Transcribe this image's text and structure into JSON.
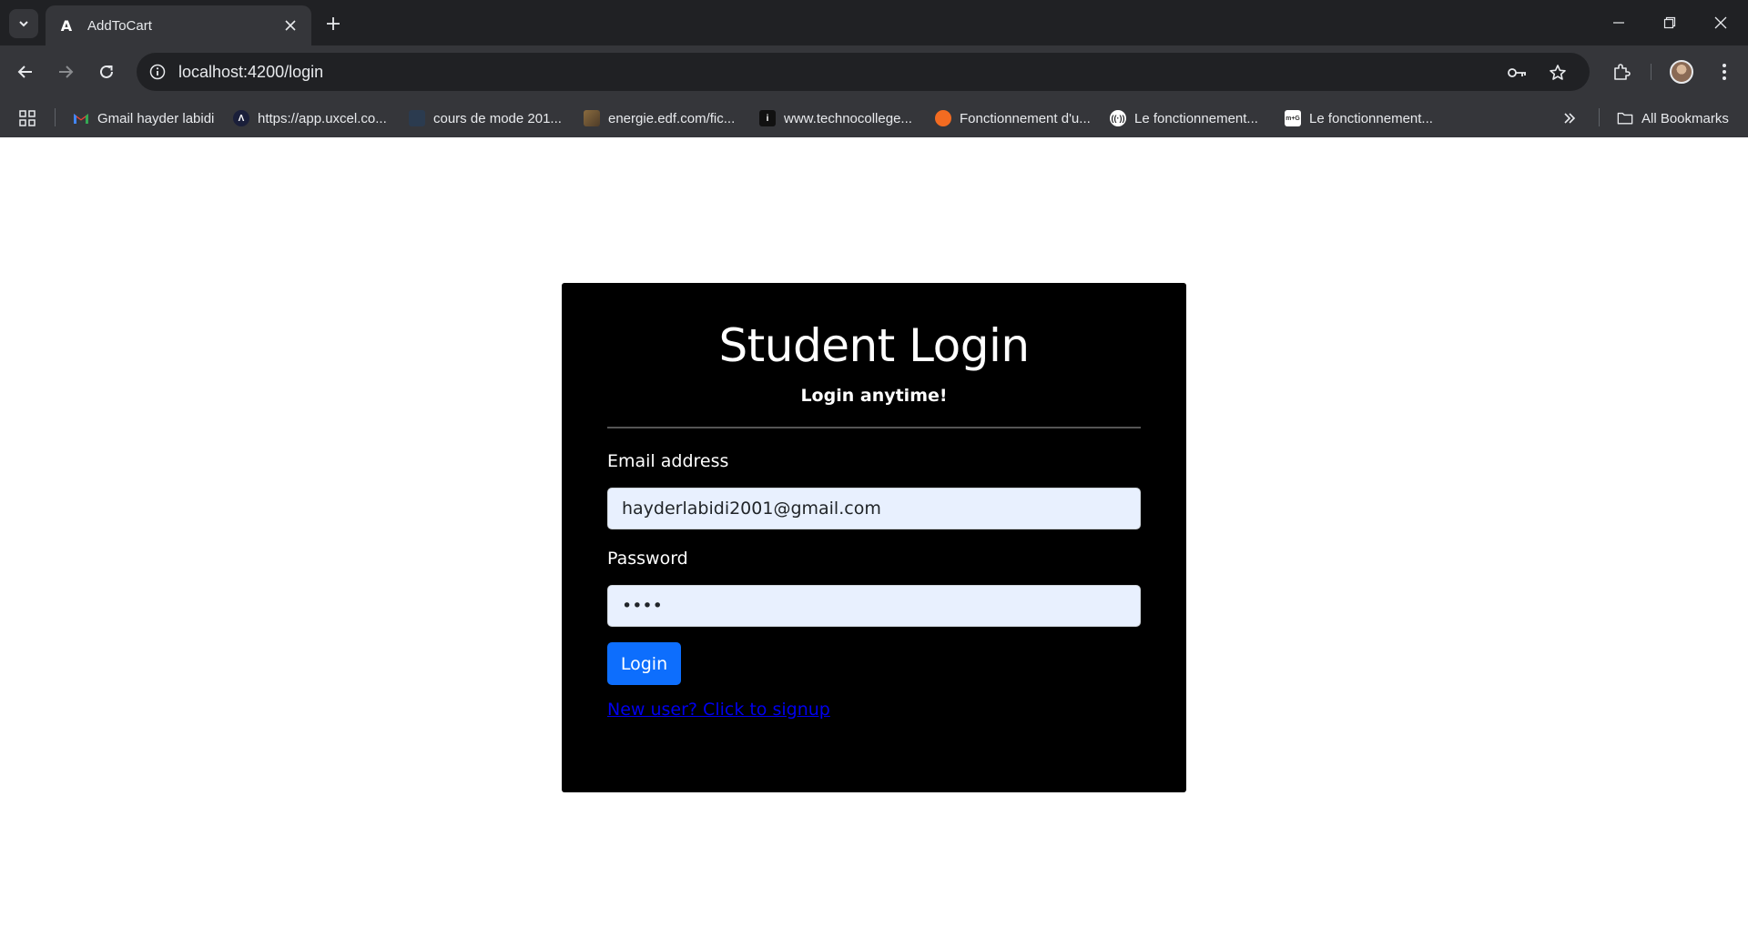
{
  "browser": {
    "tab_title": "AddToCart",
    "url": "localhost:4200/login",
    "bookmarks": [
      {
        "label": "Gmail hayder labidi",
        "icon": "gmail-icon"
      },
      {
        "label": "https://app.uxcel.co...",
        "icon": "uxcel-icon"
      },
      {
        "label": "cours de mode 201...",
        "icon": "generic-site-icon"
      },
      {
        "label": "energie.edf.com/fic...",
        "icon": "image-thumbnail-icon"
      },
      {
        "label": "www.technocollege...",
        "icon": "technocollege-icon"
      },
      {
        "label": "Fonctionnement d'u...",
        "icon": "orange-site-icon"
      },
      {
        "label": "Le fonctionnement...",
        "icon": "radio-site-icon"
      },
      {
        "label": "Le fonctionnement...",
        "icon": "mg-site-icon"
      }
    ],
    "all_bookmarks_label": "All Bookmarks"
  },
  "login": {
    "title": "Student Login",
    "subtitle": "Login anytime!",
    "email_label": "Email address",
    "email_value": "hayderlabidi2001@gmail.com",
    "password_label": "Password",
    "password_value": "••••",
    "login_button": "Login",
    "signup_link": "New user? Click to signup"
  },
  "colors": {
    "card_bg": "#000000",
    "input_bg": "#e8f0fe",
    "button_bg": "#0d6efd",
    "link": "#0000ee"
  }
}
